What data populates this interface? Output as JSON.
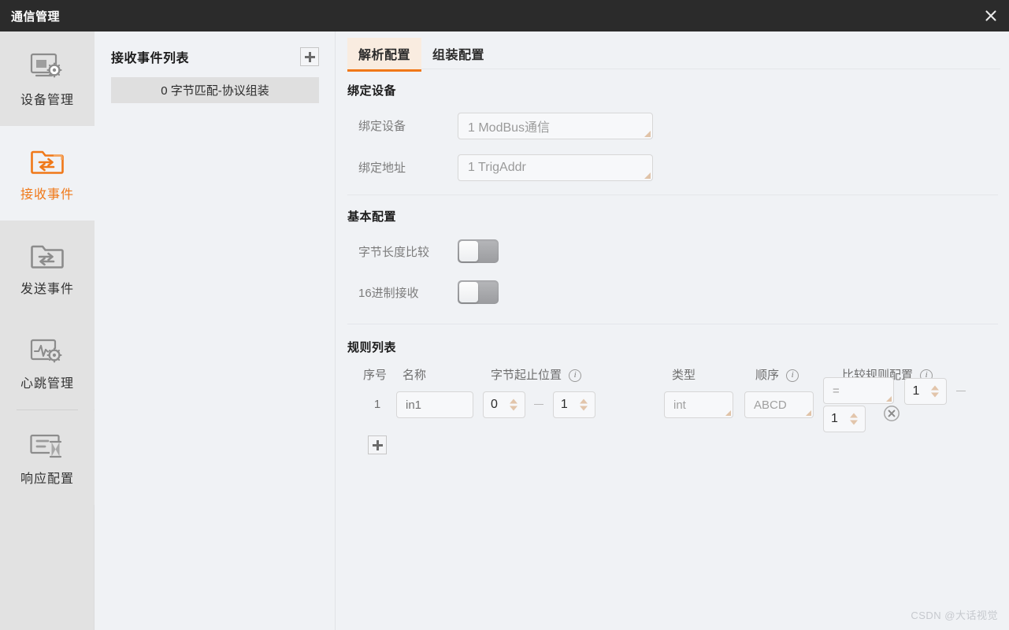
{
  "window": {
    "title": "通信管理",
    "close_icon": "close-icon"
  },
  "sidebar": {
    "items": [
      {
        "label": "设备管理",
        "icon": "monitor-gear-icon",
        "active": false
      },
      {
        "label": "接收事件",
        "icon": "folder-receive-arrow-icon",
        "active": true
      },
      {
        "label": "发送事件",
        "icon": "folder-send-arrow-icon",
        "active": false
      },
      {
        "label": "心跳管理",
        "icon": "heartbeat-gear-icon",
        "active": false
      },
      {
        "label": "响应配置",
        "icon": "list-hourglass-icon",
        "active": false
      }
    ]
  },
  "list_panel": {
    "title": "接收事件列表",
    "add_button_icon": "plus-icon",
    "items": [
      {
        "label": "0 字节匹配-协议组装",
        "selected": true
      }
    ]
  },
  "main": {
    "tabs": [
      {
        "label": "解析配置",
        "active": true
      },
      {
        "label": "组装配置",
        "active": false
      }
    ],
    "bind_device_section": {
      "title": "绑定设备",
      "fields": [
        {
          "label": "绑定设备",
          "value": "1 ModBus通信"
        },
        {
          "label": "绑定地址",
          "value": "1 TrigAddr"
        }
      ]
    },
    "basic_config_section": {
      "title": "基本配置",
      "toggles": [
        {
          "label": "字节长度比较",
          "on": false
        },
        {
          "label": "16进制接收",
          "on": false
        }
      ]
    },
    "rules_section": {
      "title": "规则列表",
      "columns": [
        {
          "label": "序号",
          "info": false
        },
        {
          "label": "名称",
          "info": false
        },
        {
          "label": "字节起止位置",
          "info": true
        },
        {
          "label": "类型",
          "info": false
        },
        {
          "label": "顺序",
          "info": true
        },
        {
          "label": "比较规则配置",
          "info": true
        }
      ],
      "rows": [
        {
          "index": "1",
          "name": "in1",
          "byte_start": "0",
          "byte_end": "1",
          "type": "int",
          "order": "ABCD",
          "compare_op": "=",
          "compare_from": "1",
          "compare_to": "1",
          "delete_icon": "delete-circle-x-icon"
        }
      ],
      "add_row_icon": "plus-icon",
      "separator": "—"
    }
  },
  "watermark": "CSDN @大话视觉",
  "colors": {
    "accent": "#f07818",
    "titlebar_bg": "#2b2b2b",
    "sidebar_bg": "#e2e2e2",
    "panel_bg": "#f0f2f5",
    "active_tab_bg": "#f9ece0"
  }
}
